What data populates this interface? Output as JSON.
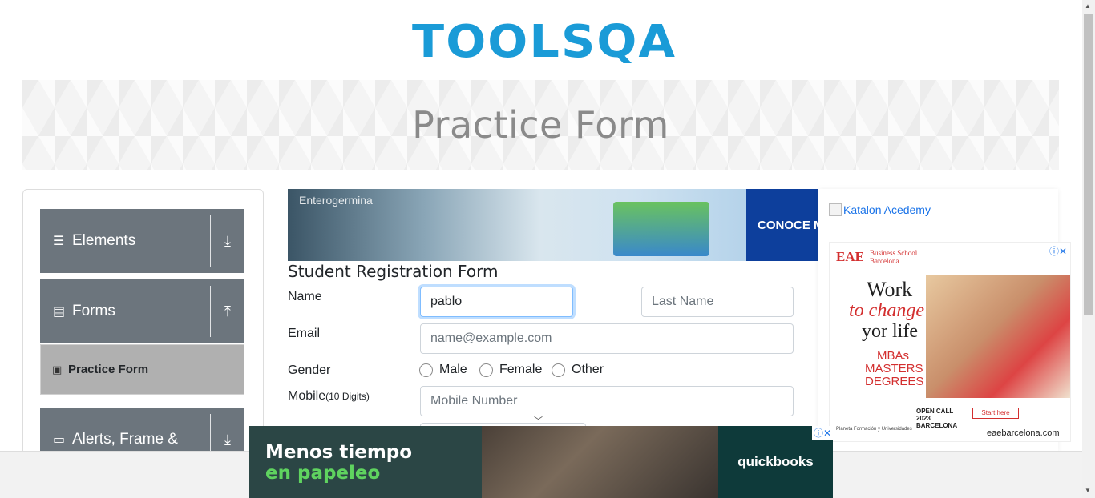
{
  "logo": {
    "text": "TOOLSQA"
  },
  "banner": {
    "title": "Practice Form"
  },
  "sidebar": {
    "groups": [
      {
        "label": "Elements",
        "icon": "hamburger-icon",
        "toggle": "download-icon"
      },
      {
        "label": "Forms",
        "icon": "document-icon",
        "toggle": "upload-icon"
      },
      {
        "label": "Alerts, Frame &",
        "icon": "window-icon",
        "toggle": "download-icon"
      }
    ],
    "active_item": {
      "label": "Practice Form",
      "icon": "form-icon"
    }
  },
  "ad_top": {
    "brand": "Enterogermina",
    "cta": "CONOCE M"
  },
  "form": {
    "title": "Student Registration Form",
    "name_label": "Name",
    "first_name_value": "pablo",
    "last_name_placeholder": "Last Name",
    "email_label": "Email",
    "email_placeholder": "name@example.com",
    "gender_label": "Gender",
    "gender_options": [
      "Male",
      "Female",
      "Other"
    ],
    "mobile_label": "Mobile",
    "mobile_hint": "(10 Digits)",
    "mobile_placeholder": "Mobile Number"
  },
  "right_ads": {
    "katalon_alt": "Katalon Acedemy",
    "eae": {
      "brand": "EAE",
      "school": "Business School Barcelona",
      "line1": "Work",
      "line2": "to change",
      "line3": "yor life",
      "degrees": "MBAs MASTERS DEGREES",
      "open_call": "OPEN CALL 2023 BARCELONA",
      "start": "Start here",
      "planeta": "Planeta Formación y Universidades",
      "url": "eaebarcelona.com"
    }
  },
  "bottom_ad": {
    "line1": "Menos tiempo",
    "line2": "en papeleo",
    "brand": "quickbooks"
  }
}
